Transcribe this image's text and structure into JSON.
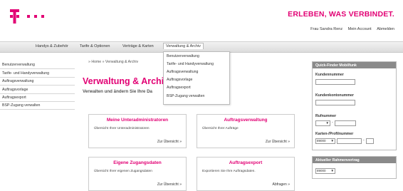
{
  "header": {
    "slogan": "ERLEBEN, WAS VERBINDET.",
    "user_name": "Frau Sandra Renz",
    "my_account": "Mein Account",
    "logout": "Abmelden"
  },
  "nav": {
    "items": [
      "Handys & Zubehör",
      "Tarife & Optionen",
      "Verträge & Karten",
      "Verwaltung & Archiv"
    ]
  },
  "dropdown": {
    "items": [
      "Benutzerverwaltung",
      "Tarife- und Handyverwaltung",
      "Auftragsverwaltung",
      "Auftragsvorlage",
      "Auftragsexport",
      "BSP-Zugang verwalten"
    ]
  },
  "sidebar": {
    "items": [
      "Benutzerverwaltung",
      "Tarife- und Handyverwaltung",
      "Auftragsverwaltung",
      "Auftragsvorlage",
      "Auftragsexport",
      "BSP-Zugang verwalten"
    ]
  },
  "breadcrumb": "» Home » Verwaltung & Archiv",
  "page": {
    "title": "Verwaltung & Archiv",
    "subtitle": "Verwalten und ändern Sie Ihre Da"
  },
  "cards": [
    {
      "title": "Meine Unteradministratoren",
      "desc": "Übersicht Ihrer Unteradministratoren",
      "link": "Zur Übersicht »"
    },
    {
      "title": "Auftragsverwaltung",
      "desc": "Übersicht Ihrer Aufträge",
      "link": "Zur Übersicht »"
    },
    {
      "title": "Eigene Zugangsdaten",
      "desc": "Übersicht Ihrer eigenen Zugangsdaten",
      "link": "Zur Übersicht »"
    },
    {
      "title": "Auftragsexport",
      "desc": "Exportieren Sie Ihre Auftragsdaten.",
      "link": "Abfragen »"
    }
  ],
  "quickfinder": {
    "title": "Quick-Finder Mobilfunk",
    "customer_number": "Kundennummer",
    "customer_account": "Kundenkontonummer",
    "phone_number": "Rufnummer",
    "card_profile": "Karten-/Profilnummer",
    "card_prefix": "89000",
    "dash": "-"
  },
  "rahmenvertrag": {
    "title": "Aktueller Rahmenvertrag",
    "select_value": "89000"
  },
  "colors": {
    "brand": "#e20074",
    "header_grey": "#8a8a8a"
  }
}
